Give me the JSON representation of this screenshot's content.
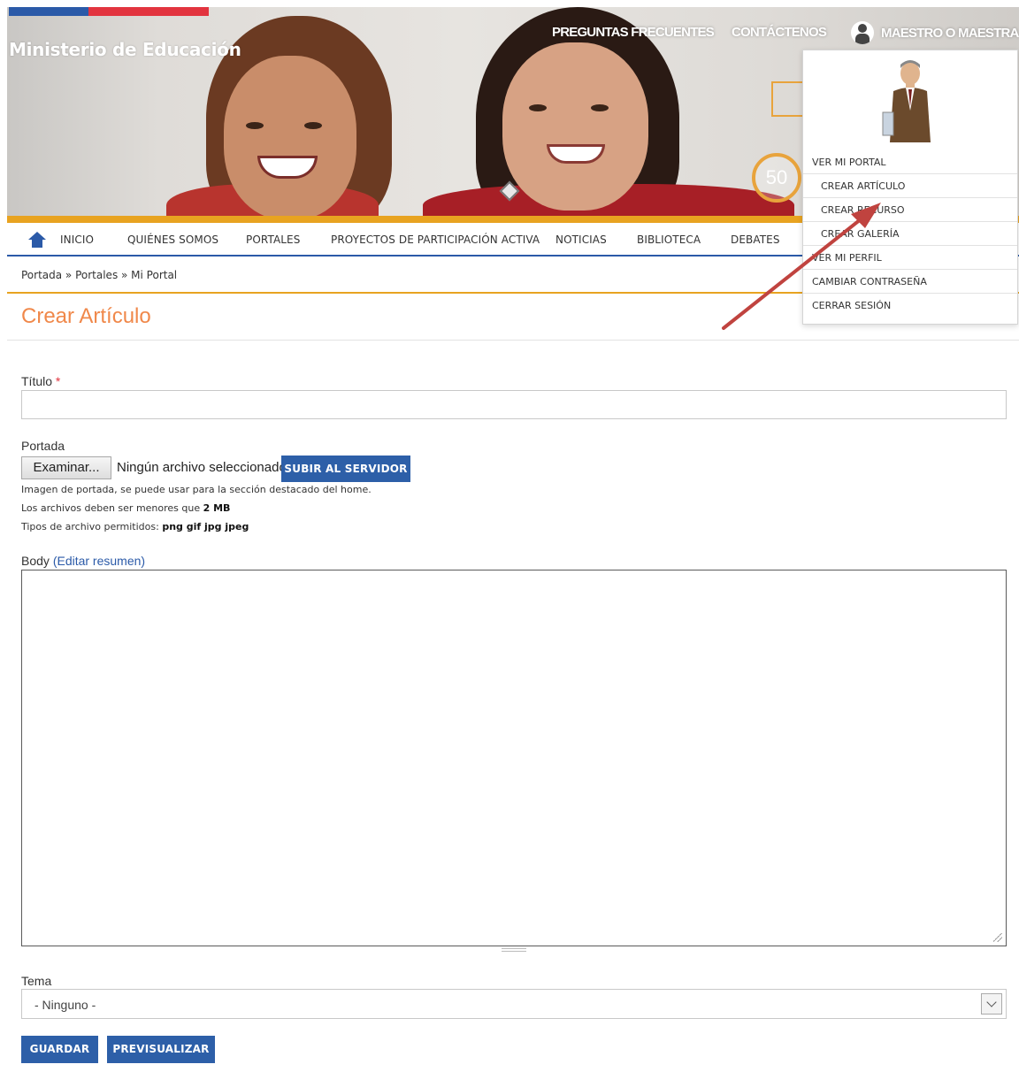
{
  "header": {
    "ministry": "Ministerio de Educación",
    "links": {
      "faq": "PREGUNTAS FRECUENTES",
      "contact": "CONTÁCTENOS",
      "user": "MAESTRO O MAESTRA"
    },
    "badge": "50"
  },
  "nav": {
    "items": [
      "INICIO",
      "QUIÉNES SOMOS",
      "PORTALES",
      "PROYECTOS DE PARTICIPACIÓN ACTIVA",
      "NOTICIAS",
      "BIBLIOTECA",
      "DEBATES"
    ]
  },
  "breadcrumb": "Portada » Portales » Mi Portal",
  "page_title": "Crear Artículo",
  "form": {
    "title_label": "Título",
    "required_mark": "*",
    "cover_label": "Portada",
    "browse_button": "Examinar...",
    "no_file": "Ningún archivo seleccionado.",
    "upload_button": "SUBIR AL SERVIDOR",
    "help_1": "Imagen de portada, se puede usar para la sección destacado del home.",
    "help_2_prefix": "Los archivos deben ser menores que",
    "help_2_size": "2 MB",
    "help_3_prefix": "Tipos de archivo permitidos:",
    "help_3_types": "png gif jpg jpeg",
    "body_label": "Body",
    "body_link": "(Editar resumen)",
    "topic_label": "Tema",
    "topic_value": "- Ninguno -",
    "save_button": "GUARDAR",
    "preview_button": "PREVISUALIZAR"
  },
  "dropdown": {
    "items": [
      "VER MI PORTAL",
      "CREAR ARTÍCULO",
      "CREAR RECURSO",
      "CREAR GALERÍA",
      "VER MI PERFIL",
      "CAMBIAR CONTRASEÑA",
      "CERRAR SESIÓN"
    ]
  },
  "colors": {
    "brand_blue": "#2b5aa8",
    "accent_orange": "#e8a320",
    "title_orange": "#f0884a",
    "annotation_arrow": "#c0433f"
  }
}
